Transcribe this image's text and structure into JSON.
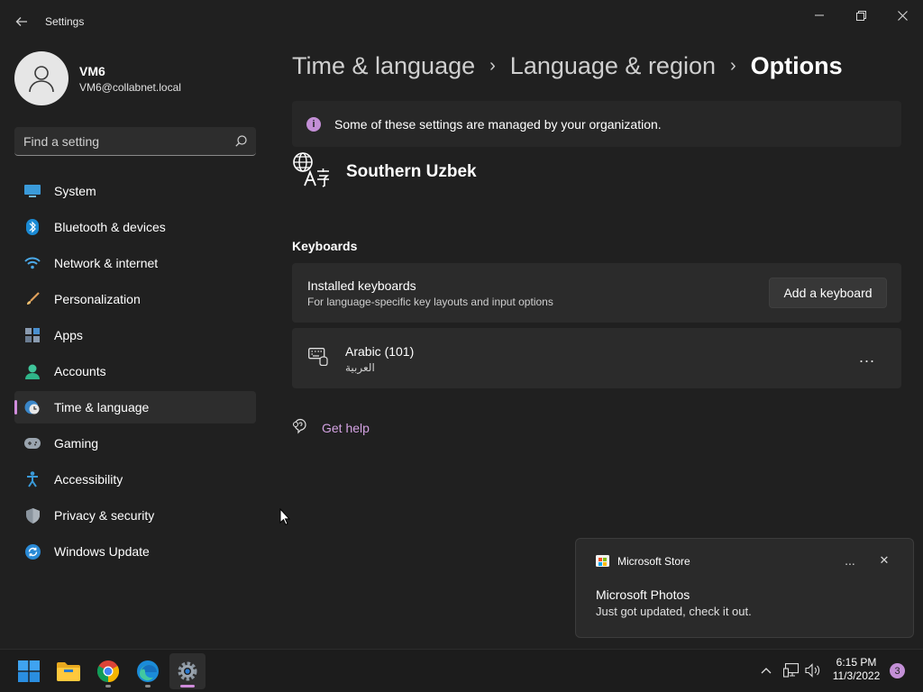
{
  "window": {
    "title": "Settings",
    "back_icon": "arrow-left-icon",
    "minimize_icon": "minimize-icon",
    "restore_icon": "restore-icon",
    "close_icon": "close-icon"
  },
  "profile": {
    "name": "VM6",
    "email": "VM6@collabnet.local"
  },
  "search": {
    "placeholder": "Find a setting"
  },
  "sidebar": {
    "items": [
      {
        "label": "System",
        "icon": "system-icon"
      },
      {
        "label": "Bluetooth & devices",
        "icon": "bluetooth-icon"
      },
      {
        "label": "Network & internet",
        "icon": "wifi-icon"
      },
      {
        "label": "Personalization",
        "icon": "brush-icon"
      },
      {
        "label": "Apps",
        "icon": "apps-icon"
      },
      {
        "label": "Accounts",
        "icon": "person-icon"
      },
      {
        "label": "Time & language",
        "icon": "clock-globe-icon",
        "active": true
      },
      {
        "label": "Gaming",
        "icon": "gamepad-icon"
      },
      {
        "label": "Accessibility",
        "icon": "accessibility-icon"
      },
      {
        "label": "Privacy & security",
        "icon": "shield-icon"
      },
      {
        "label": "Windows Update",
        "icon": "update-icon"
      }
    ]
  },
  "breadcrumb": {
    "items": [
      "Time & language",
      "Language & region"
    ],
    "current": "Options"
  },
  "info_bar": {
    "text": "Some of these settings are managed by your organization.",
    "icon": "info-icon"
  },
  "language": {
    "name": "Southern Uzbek",
    "icon": "language-icon"
  },
  "keyboards": {
    "section_title": "Keyboards",
    "installed_title": "Installed keyboards",
    "installed_desc": "For language-specific key layouts and input options",
    "add_button": "Add a keyboard",
    "items": [
      {
        "name": "Arabic (101)",
        "native": "العربية",
        "icon": "keyboard-icon"
      }
    ],
    "more_label": "..."
  },
  "help": {
    "label": "Get help",
    "icon": "help-icon"
  },
  "toast": {
    "app": "Microsoft Store",
    "title": "Microsoft Photos",
    "body": "Just got updated, check it out.",
    "more_label": "...",
    "close_label": "✕"
  },
  "taskbar": {
    "apps": [
      "start-icon",
      "file-explorer-icon",
      "chrome-icon",
      "edge-icon",
      "settings-icon"
    ],
    "time": "6:15 PM",
    "date": "11/3/2022",
    "notification_count": "3"
  },
  "colors": {
    "accent": "#d08cdb",
    "link": "#d3a2e2",
    "background": "#202020",
    "card": "#2b2b2b"
  }
}
